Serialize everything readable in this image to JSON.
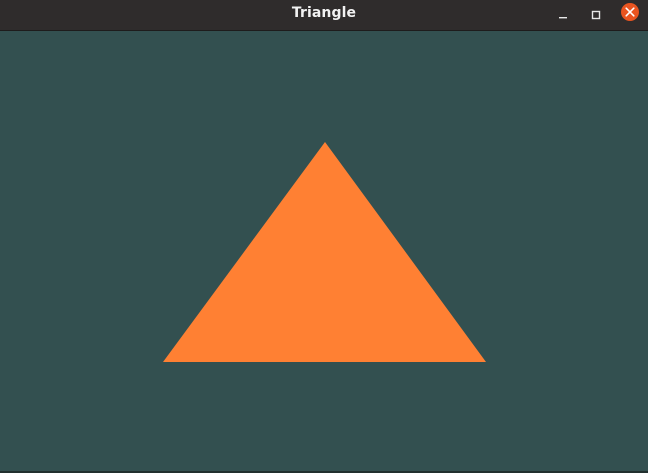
{
  "window": {
    "title": "Triangle",
    "background_color": "#335050",
    "titlebar_color": "#2f2c2c"
  },
  "controls": {
    "minimize_icon": "minimize-icon",
    "maximize_icon": "maximize-icon",
    "close_icon": "close-icon",
    "close_color": "#e95420"
  },
  "scene": {
    "shape": "triangle",
    "fill_color": "#ff8033"
  }
}
